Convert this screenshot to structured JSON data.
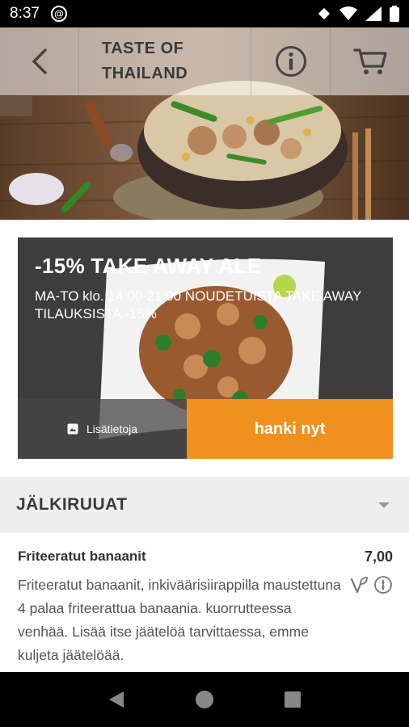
{
  "status_bar": {
    "time": "8:37"
  },
  "header": {
    "title": "TASTE OF\nTHAILAND",
    "back_icon": "back-arrow-icon",
    "info_icon": "info-icon",
    "cart_icon": "cart-icon"
  },
  "promo": {
    "title": "-15% TAKE AWAY ALE",
    "description": "MA-TO klo. 14:00-21:00 NOUDETUISTA TAKE AWAY TILAUKSISTA -15%",
    "more_label": "Lisätietoja",
    "cta_label": "hanki nyt"
  },
  "category": {
    "title": "JÄLKIRUUAT"
  },
  "item": {
    "name": "Friteeratut banaanit",
    "price": "7,00",
    "description": "Friteeratut banaanit, inkiväärisiirappilla maustettuna 4 palaa friteerattua banaania. kuorrutteessa venhää. Lisää itse jäätelöä tarvittaessa, emme kuljeta jäätelöää."
  },
  "colors": {
    "accent": "#f0901e",
    "category_bg": "#eeeeee"
  }
}
